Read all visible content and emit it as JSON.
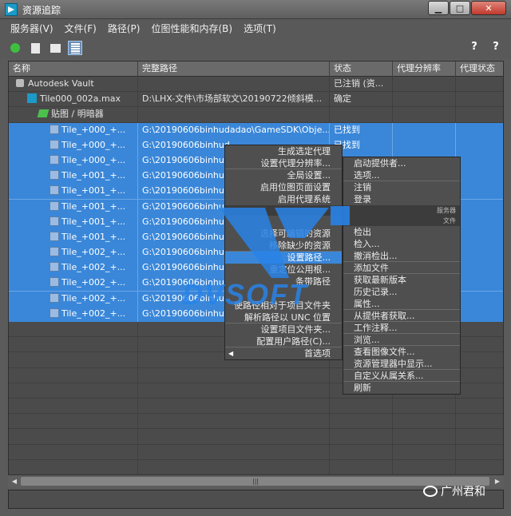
{
  "window": {
    "title": "资源追踪",
    "controls": {
      "minimize": "▁",
      "maximize": "□",
      "close": "✕"
    }
  },
  "menubar": [
    "服务器(V)",
    "文件(F)",
    "路径(P)",
    "位图性能和内存(B)",
    "选项(T)"
  ],
  "toolbar": {
    "icons": [
      "refresh-icon",
      "list-view-icon",
      "thumbnail-view-icon",
      "table-view-icon"
    ],
    "active": "table-view-icon",
    "help_icons": [
      "?",
      "?"
    ]
  },
  "table": {
    "columns": [
      "名称",
      "完整路径",
      "状态",
      "代理分辨率",
      "代理状态"
    ],
    "rows": [
      {
        "icon": "vault-icon",
        "indent": 1,
        "name": "Autodesk Vault",
        "path": "",
        "status": "已注销 (资...",
        "selected": false
      },
      {
        "icon": "max-file-icon",
        "indent": 2,
        "name": "Tile000_002a.max",
        "path": "D:\\LHX-文件\\市场部软文\\20190722倾斜模...",
        "status": "确定",
        "selected": false
      },
      {
        "icon": "map-icon",
        "indent": 3,
        "name": "贴图 / 明暗器",
        "path": "",
        "status": "",
        "selected": false
      },
      {
        "icon": "image-file-icon",
        "indent": 4,
        "name": "Tile_+000_+...",
        "path": "G:\\20190606binhudadao\\GameSDK\\Obje...",
        "status": "已找到",
        "selected": true
      },
      {
        "icon": "image-file-icon",
        "indent": 4,
        "name": "Tile_+000_+...",
        "path": "G:\\20190606binhud",
        "status": "已找到",
        "selected": true
      },
      {
        "icon": "image-file-icon",
        "indent": 4,
        "name": "Tile_+000_+...",
        "path": "G:\\20190606binhud",
        "status": "",
        "selected": true
      },
      {
        "icon": "image-file-icon",
        "indent": 4,
        "name": "Tile_+001_+...",
        "path": "G:\\20190606binhud",
        "status": "",
        "selected": true
      },
      {
        "icon": "image-file-icon",
        "indent": 4,
        "name": "Tile_+001_+...",
        "path": "G:\\20190606binhud",
        "status": "",
        "selected": true
      },
      {
        "icon": "image-file-icon",
        "indent": 4,
        "name": "Tile_+001_+...",
        "path": "G:\\20190606binhud",
        "status": "",
        "selected": true
      },
      {
        "icon": "image-file-icon",
        "indent": 4,
        "name": "Tile_+001_+...",
        "path": "G:\\20190606binhud",
        "status": "",
        "selected": true
      },
      {
        "icon": "image-file-icon",
        "indent": 4,
        "name": "Tile_+001_+...",
        "path": "G:\\20190606binhud",
        "status": "",
        "selected": true
      },
      {
        "icon": "image-file-icon",
        "indent": 4,
        "name": "Tile_+002_+...",
        "path": "G:\\20190606binhud",
        "status": "",
        "selected": true
      },
      {
        "icon": "image-file-icon",
        "indent": 4,
        "name": "Tile_+002_+...",
        "path": "G:\\20190606binhud",
        "status": "",
        "selected": true
      },
      {
        "icon": "image-file-icon",
        "indent": 4,
        "name": "Tile_+002_+...",
        "path": "G:\\20190606binhud",
        "status": "",
        "selected": true
      },
      {
        "icon": "image-file-icon",
        "indent": 4,
        "name": "Tile_+002_+...",
        "path": "G:\\20190606binhud",
        "status": "",
        "selected": true
      },
      {
        "icon": "image-file-icon",
        "indent": 4,
        "name": "Tile_+002_+...",
        "path": "G:\\20190606binhuo",
        "status": "",
        "selected": true
      }
    ],
    "empty_rows": 10
  },
  "context_menu_left": {
    "items": [
      {
        "label": "生成选定代理",
        "highlight": false
      },
      {
        "label": "设置代理分辨率...",
        "highlight": false,
        "sep": true
      },
      {
        "label": "全局设置...",
        "highlight": false
      },
      {
        "label": "启用位图页面设置",
        "highlight": false
      },
      {
        "label": "启用代理系统",
        "highlight": false
      },
      {
        "label": "",
        "header": true
      },
      {
        "label": "",
        "highlight": false
      },
      {
        "label": "选择可编辑的资源",
        "highlight": false
      },
      {
        "label": "移除缺少的资源",
        "highlight": false,
        "sep": true
      },
      {
        "label": "设置路径...",
        "highlight": true
      },
      {
        "label": "重定位公用根...",
        "highlight": false
      },
      {
        "label": "条带路径",
        "highlight": false
      },
      {
        "label": "",
        "highlight": false
      },
      {
        "label": "使路径相对于项目文件夹",
        "highlight": false
      },
      {
        "label": "解析路径以 UNC 位置",
        "highlight": false,
        "sep": true
      },
      {
        "label": "设置项目文件夹...",
        "highlight": false
      },
      {
        "label": "配置用户路径(C)...",
        "highlight": false,
        "sep": true
      },
      {
        "label": "首选项",
        "highlight": false,
        "submenu": true
      }
    ]
  },
  "context_menu_right": {
    "items": [
      {
        "label": "启动提供者...",
        "sep": false
      },
      {
        "label": "选项...",
        "sep": true
      },
      {
        "label": "注销"
      },
      {
        "label": "登录"
      },
      {
        "label": "服务器",
        "header": true
      },
      {
        "label": "文件",
        "header": true
      },
      {
        "label": "检出"
      },
      {
        "label": "检入..."
      },
      {
        "label": "撤消检出...",
        "sep": true
      },
      {
        "label": "添加文件",
        "sep": true
      },
      {
        "label": "获取最新版本"
      },
      {
        "label": "历史记录..."
      },
      {
        "label": "属性...",
        "sep": true
      },
      {
        "label": "从提供者获取...",
        "sep": true
      },
      {
        "label": "工作注释...",
        "sep": true
      },
      {
        "label": "浏览...",
        "sep": true
      },
      {
        "label": "查看图像文件..."
      },
      {
        "label": "资源管理器中显示...",
        "sep": true
      },
      {
        "label": "自定义从属关系...",
        "sep": true
      },
      {
        "label": "刷新"
      }
    ]
  },
  "watermark": {
    "brand": "DVSOFT"
  },
  "corner_badge": "广州君和"
}
